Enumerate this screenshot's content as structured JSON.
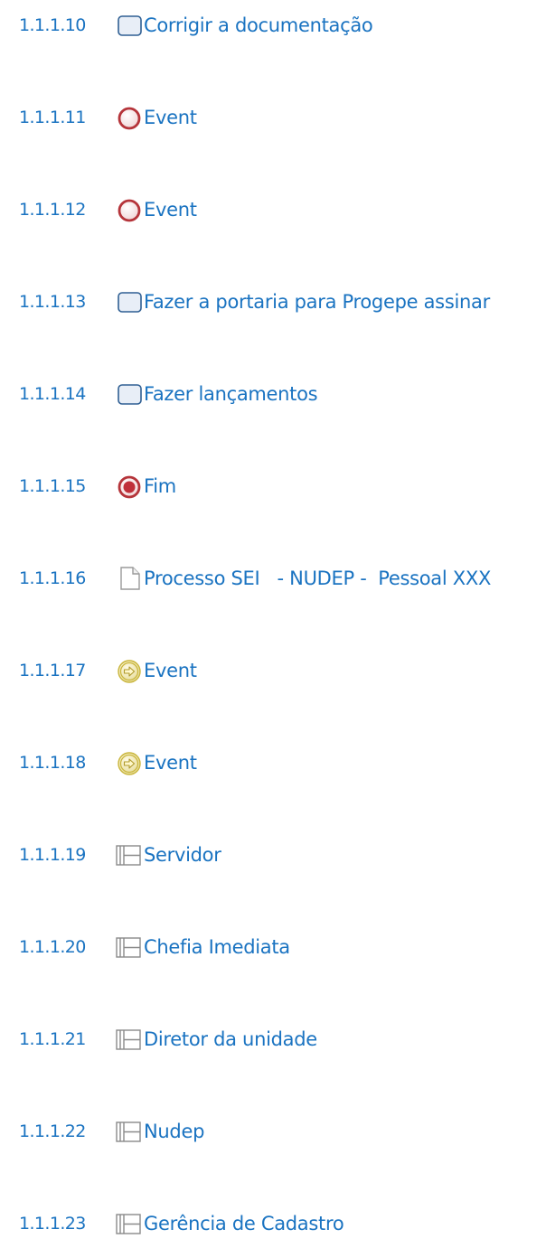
{
  "outline": {
    "entries": [
      {
        "number": "1.1.1.10",
        "icon": "task-icon",
        "label": "Corrigir a documentação"
      },
      {
        "number": "1.1.1.11",
        "icon": "end-event-icon",
        "label": "Event"
      },
      {
        "number": "1.1.1.12",
        "icon": "end-event-icon",
        "label": "Event"
      },
      {
        "number": "1.1.1.13",
        "icon": "task-icon",
        "label": "Fazer a portaria para Progepe assinar"
      },
      {
        "number": "1.1.1.14",
        "icon": "task-icon",
        "label": "Fazer lançamentos"
      },
      {
        "number": "1.1.1.15",
        "icon": "terminate-end-event-icon",
        "label": "Fim"
      },
      {
        "number": "1.1.1.16",
        "icon": "document-icon",
        "label": "Processo SEI   - NUDEP -  Pessoal XXX"
      },
      {
        "number": "1.1.1.17",
        "icon": "link-event-icon",
        "label": "Event"
      },
      {
        "number": "1.1.1.18",
        "icon": "link-event-icon",
        "label": "Event"
      },
      {
        "number": "1.1.1.19",
        "icon": "lane-icon",
        "label": "Servidor"
      },
      {
        "number": "1.1.1.20",
        "icon": "lane-icon",
        "label": "Chefia Imediata"
      },
      {
        "number": "1.1.1.21",
        "icon": "lane-icon",
        "label": "Diretor da unidade"
      },
      {
        "number": "1.1.1.22",
        "icon": "lane-icon",
        "label": "Nudep"
      },
      {
        "number": "1.1.1.23",
        "icon": "lane-icon",
        "label": "Gerência de Cadastro"
      }
    ]
  },
  "colors": {
    "text": "#1a73c1",
    "task_border": "#2f5f93",
    "task_fill": "#e8eef7",
    "end_event": "#b5343a",
    "link_event": "#c9b53a",
    "lane": "#8a8a8a",
    "document_border": "#9a9a9a"
  }
}
